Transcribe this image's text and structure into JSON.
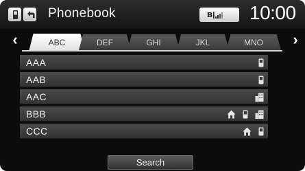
{
  "header": {
    "title": "Phonebook",
    "bluetooth_symbol": "ʙ",
    "clock": "10:00",
    "icons": [
      "phone-icon",
      "back-arrow-icon",
      "bluetooth-icon",
      "signal-strength-icon"
    ]
  },
  "tabs": [
    {
      "label": "ABC",
      "active": true
    },
    {
      "label": "DEF",
      "active": false
    },
    {
      "label": "GHI",
      "active": false
    },
    {
      "label": "JKL",
      "active": false
    },
    {
      "label": "MNO",
      "active": false
    }
  ],
  "nav": {
    "prev_symbol": "‹",
    "next_symbol": "›"
  },
  "contacts": [
    {
      "name": "AAA",
      "icons": [
        "mobile-icon"
      ]
    },
    {
      "name": "AAB",
      "icons": [
        "mobile-icon"
      ]
    },
    {
      "name": "AAC",
      "icons": [
        "office-icon"
      ]
    },
    {
      "name": "BBB",
      "icons": [
        "home-icon",
        "mobile-icon",
        "office-icon"
      ]
    },
    {
      "name": "CCC",
      "icons": [
        "home-icon",
        "mobile-icon"
      ]
    }
  ],
  "search_label": "Search",
  "colors": {
    "background": "#0c0c0c",
    "row": "#404040",
    "active_tab": "#ffffff",
    "text": "#f2f2f2"
  }
}
